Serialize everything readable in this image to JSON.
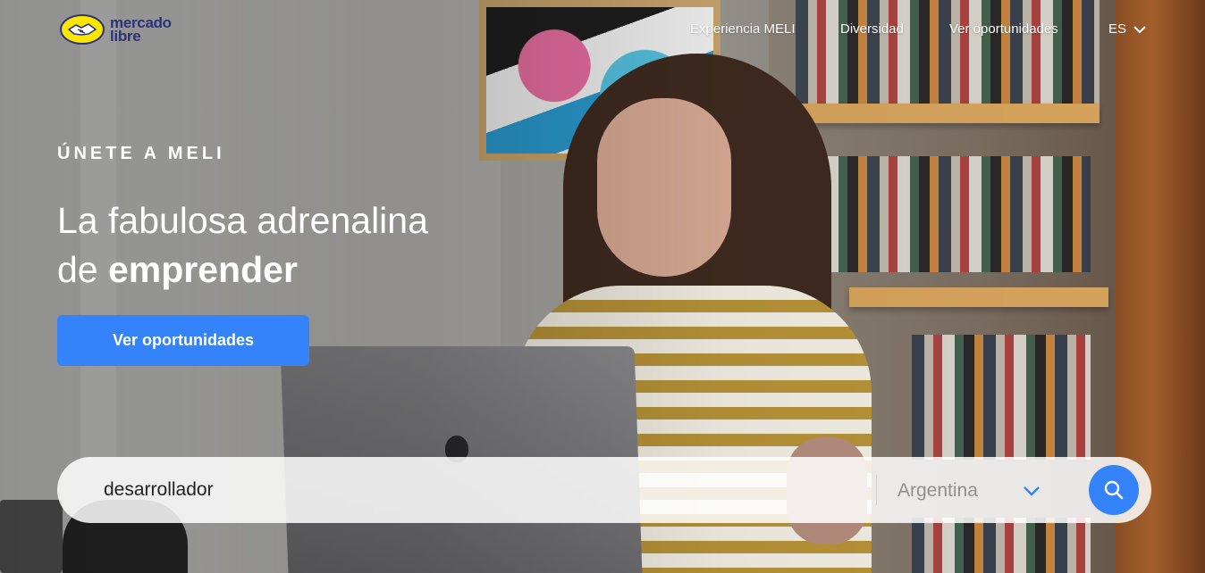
{
  "header": {
    "logo_line1": "mercado",
    "logo_line2": "libre",
    "nav": [
      {
        "label": "Experiencia MELI"
      },
      {
        "label": "Diversidad"
      },
      {
        "label": "Ver oportunidades"
      }
    ],
    "language": "ES"
  },
  "hero": {
    "eyebrow": "ÚNETE A MELI",
    "headline_line1": "La fabulosa adrenalina",
    "headline_line2_prefix": "de ",
    "headline_line2_bold": "emprender",
    "cta_label": "Ver oportunidades"
  },
  "search": {
    "query": "desarrollador",
    "country": "Argentina"
  },
  "colors": {
    "accent": "#3483fa",
    "logo_yellow": "#ffe600",
    "logo_navy": "#2d3277"
  }
}
